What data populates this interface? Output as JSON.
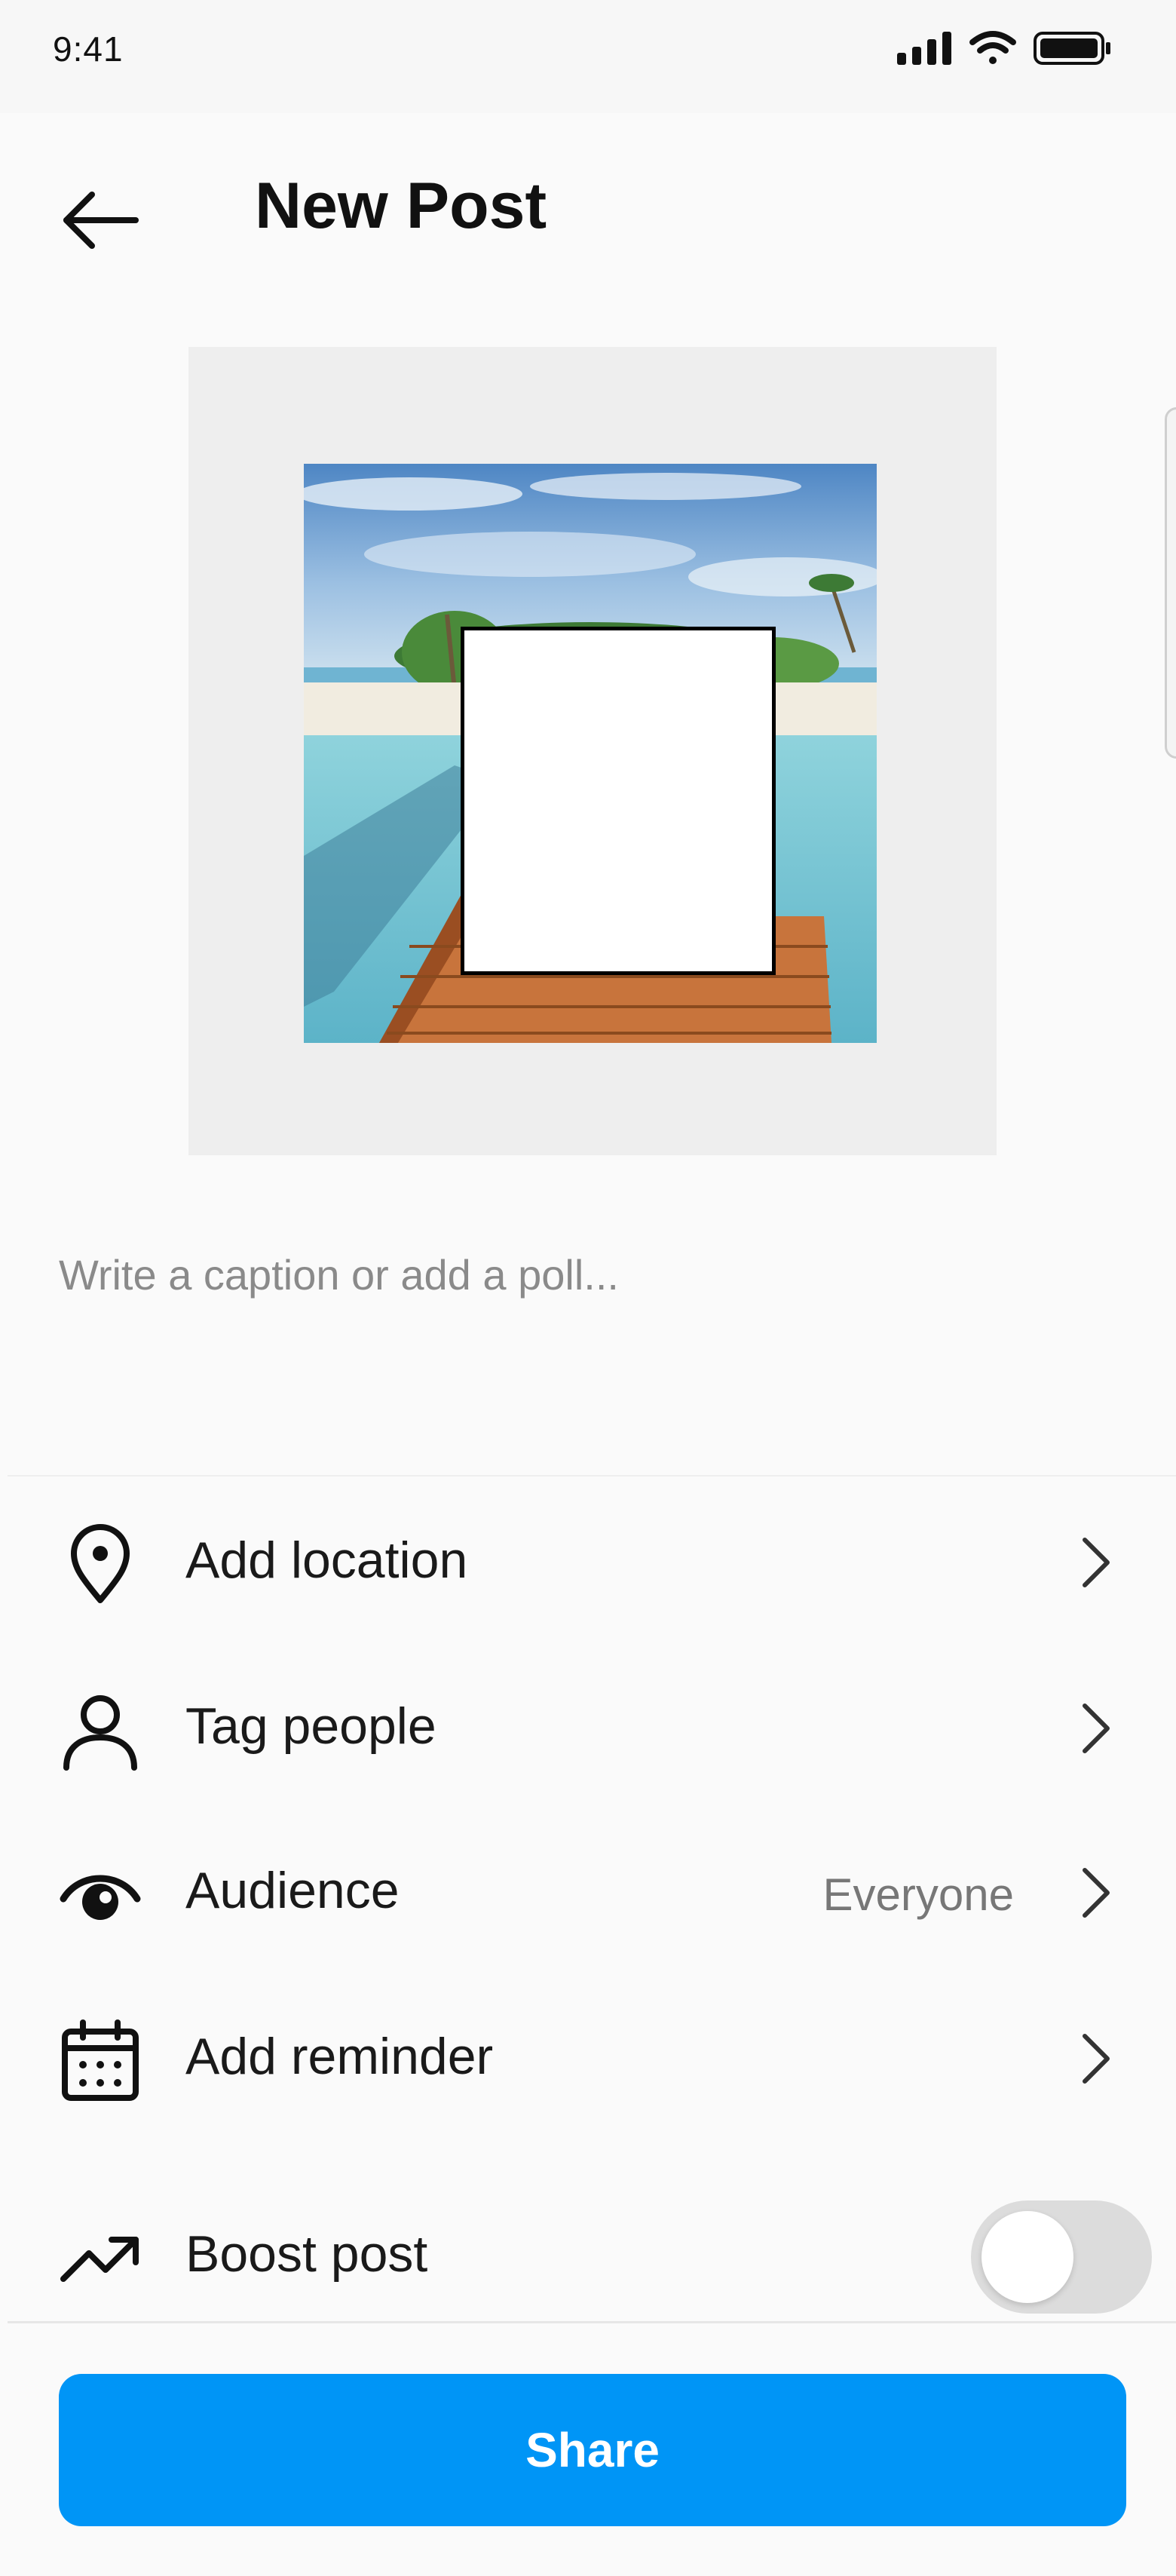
{
  "status_bar": {
    "time": "9:41",
    "icons": [
      "signal-icon",
      "wifi-icon",
      "battery-icon"
    ]
  },
  "header": {
    "title": "New Post",
    "back_icon": "arrow-left-icon"
  },
  "caption": {
    "placeholder": "Write a caption or add a poll...",
    "value": ""
  },
  "options": [
    {
      "label": "Add location",
      "icon": "location-pin-icon",
      "value": ""
    },
    {
      "label": "Tag people",
      "icon": "person-icon",
      "value": ""
    },
    {
      "label": "Audience",
      "icon": "eye-icon",
      "value": "Everyone"
    },
    {
      "label": "Add reminder",
      "icon": "calendar-icon",
      "value": ""
    }
  ],
  "boost": {
    "label": "Boost post",
    "icon": "trending-up-icon",
    "enabled": false
  },
  "share": {
    "label": "Share"
  },
  "colors": {
    "accent": "#0095f6",
    "background": "#fafafa",
    "toggle_off": "#dcdcdc",
    "media_frame": "#eeeeee"
  }
}
